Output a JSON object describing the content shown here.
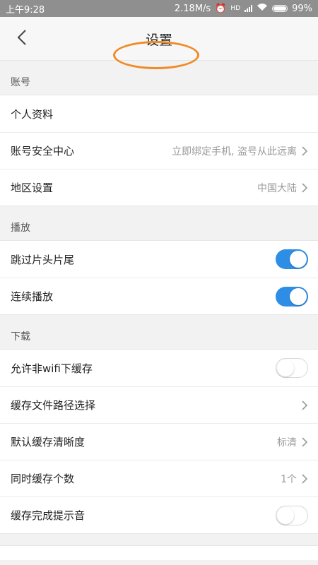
{
  "status_bar": {
    "time": "上午9:28",
    "net_speed": "2.18M/s",
    "network_type": "HD",
    "battery": "99%"
  },
  "header": {
    "title": "设置",
    "back_icon": "chevron-left-icon",
    "highlight_color": "#f08a24"
  },
  "sections": {
    "account": {
      "title": "账号",
      "items": [
        {
          "label": "个人资料"
        },
        {
          "label": "账号安全中心",
          "value": "立即绑定手机, 盗号从此远离"
        },
        {
          "label": "地区设置",
          "value": "中国大陆"
        }
      ]
    },
    "play": {
      "title": "播放",
      "items": [
        {
          "label": "跳过片头片尾",
          "toggle": true
        },
        {
          "label": "连续播放",
          "toggle": true
        }
      ]
    },
    "download": {
      "title": "下载",
      "items": [
        {
          "label": "允许非wifi下缓存",
          "toggle": false
        },
        {
          "label": "缓存文件路径选择"
        },
        {
          "label": "默认缓存清晰度",
          "value": "标清"
        },
        {
          "label": "同时缓存个数",
          "value": "1个"
        },
        {
          "label": "缓存完成提示音",
          "toggle": false
        }
      ]
    }
  },
  "colors": {
    "toggle_on": "#2e8ee6",
    "accent_annotation": "#f08a24"
  }
}
